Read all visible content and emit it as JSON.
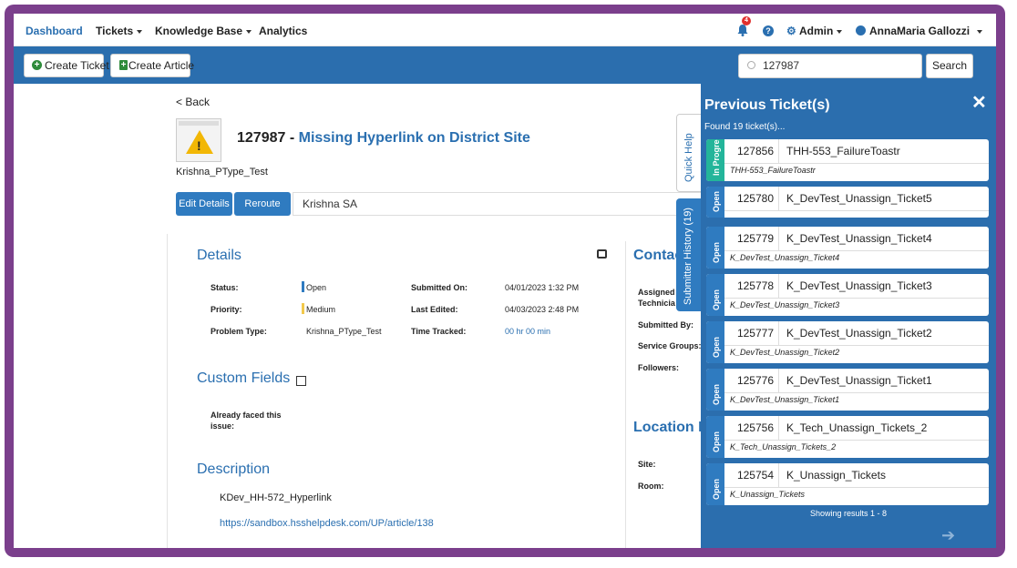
{
  "nav": {
    "dashboard": "Dashboard",
    "tickets": "Tickets",
    "knowledge_base": "Knowledge Base",
    "analytics": "Analytics",
    "notification_count": "4",
    "admin": "Admin",
    "user": "AnnaMaria Gallozzi"
  },
  "toolbar": {
    "create_ticket": "Create Ticket",
    "create_article": "Create Article",
    "search_value": "127987",
    "search_button": "Search"
  },
  "ticket": {
    "back": "< Back",
    "id_prefix": "127987 - ",
    "title": "Missing Hyperlink on District Site",
    "problem_type_label": "Krishna_PType_Test",
    "edit_details": "Edit Details",
    "reroute": "Reroute",
    "assignee": "Krishna SA"
  },
  "details": {
    "heading": "Details",
    "status_label": "Status:",
    "status_value": "Open",
    "priority_label": "Priority:",
    "priority_value": "Medium",
    "problem_type_label": "Problem Type:",
    "problem_type_value": "Krishna_PType_Test",
    "submitted_on_label": "Submitted On:",
    "submitted_on_value": "04/01/2023 1:32 PM",
    "last_edited_label": "Last Edited:",
    "last_edited_value": "04/03/2023 2:48 PM",
    "time_tracked_label": "Time Tracked:",
    "time_tracked_value": "00 hr 00 min",
    "colors": {
      "status": "#2f7bc0",
      "priority": "#f2c94c"
    }
  },
  "custom_fields": {
    "heading": "Custom Fields",
    "field_label_1": "Already faced this",
    "field_label_2": "issue:"
  },
  "description": {
    "heading": "Description",
    "text": "KDev_HH-572_Hyperlink",
    "link": "https://sandbox.hsshelpdesk.com/UP/article/138"
  },
  "contact": {
    "heading": "Contac",
    "assigned_1": "Assigned",
    "assigned_2": "Technicia",
    "submitted_by": "Submitted By:",
    "service_groups": "Service Groups:",
    "followers": "Followers:"
  },
  "location": {
    "heading": "Location In",
    "site": "Site:",
    "room": "Room:"
  },
  "side_tabs": {
    "quick_help": "Quick Help",
    "submitter_history": "Submitter History (19)"
  },
  "previous": {
    "title": "Previous Ticket(s)",
    "found": "Found 19 ticket(s)...",
    "showing": "Showing results 1 - 8",
    "tickets": [
      {
        "status": "In Progress",
        "id": "127856",
        "name": "THH-553_FailureToastr",
        "sub": "THH-553_FailureToastr"
      },
      {
        "status": "Open",
        "id": "125780",
        "name": "K_DevTest_Unassign_Ticket5",
        "sub": ""
      },
      {
        "status": "Open",
        "id": "125779",
        "name": "K_DevTest_Unassign_Ticket4",
        "sub": "K_DevTest_Unassign_Ticket4"
      },
      {
        "status": "Open",
        "id": "125778",
        "name": "K_DevTest_Unassign_Ticket3",
        "sub": "K_DevTest_Unassign_Ticket3"
      },
      {
        "status": "Open",
        "id": "125777",
        "name": "K_DevTest_Unassign_Ticket2",
        "sub": "K_DevTest_Unassign_Ticket2"
      },
      {
        "status": "Open",
        "id": "125776",
        "name": "K_DevTest_Unassign_Ticket1",
        "sub": "K_DevTest_Unassign_Ticket1"
      },
      {
        "status": "Open",
        "id": "125756",
        "name": "K_Tech_Unassign_Tickets_2",
        "sub": "K_Tech_Unassign_Tickets_2"
      },
      {
        "status": "Open",
        "id": "125754",
        "name": "K_Unassign_Tickets",
        "sub": "K_Unassign_Tickets"
      }
    ]
  }
}
